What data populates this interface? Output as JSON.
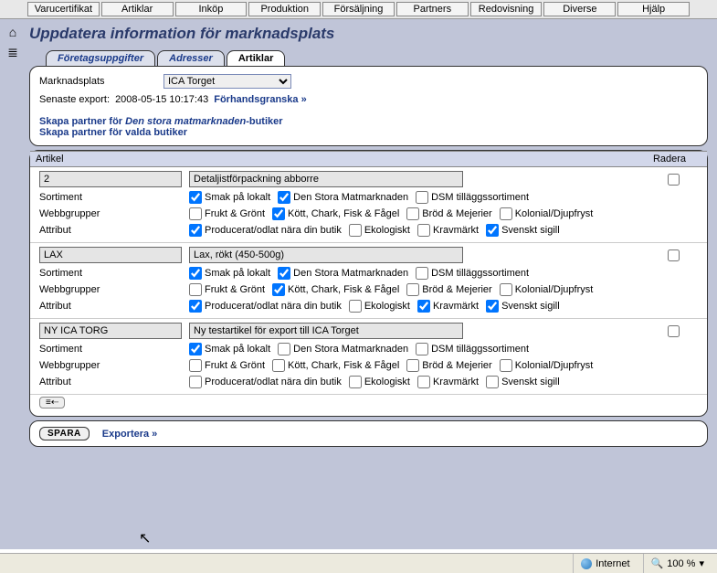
{
  "menu": [
    "Varucertifikat",
    "Artiklar",
    "Inköp",
    "Produktion",
    "Försäljning",
    "Partners",
    "Redovisning",
    "Diverse",
    "Hjälp"
  ],
  "page_title": "Uppdatera information för marknadsplats",
  "tabs": [
    {
      "label": "Företagsuppgifter",
      "active": false
    },
    {
      "label": "Adresser",
      "active": false
    },
    {
      "label": "Artiklar",
      "active": true
    }
  ],
  "marketplace": {
    "label": "Marknadsplats",
    "selected": "ICA Torget"
  },
  "export_line": {
    "prefix": "Senaste export: ",
    "ts": "2008-05-15 10:17:43",
    "preview": "Förhandsgranska »"
  },
  "partner_links": {
    "l1a": "Skapa partner för ",
    "l1b": "Den stora matmarknaden",
    "l1c": "-butiker",
    "l2": "Skapa partner för valda butiker"
  },
  "grid": {
    "col_article": "Artikel",
    "col_delete": "Radera"
  },
  "row_labels": {
    "sortiment": "Sortiment",
    "webbgrupper": "Webbgrupper",
    "attribut": "Attribut"
  },
  "sortiment_opts": [
    "Smak på lokalt",
    "Den Stora Matmarknaden",
    "DSM tilläggssortiment"
  ],
  "webb_opts": [
    "Frukt & Grönt",
    "Kött, Chark, Fisk & Fågel",
    "Bröd & Mejerier",
    "Kolonial/Djupfryst"
  ],
  "attr_opts": [
    "Producerat/odlat nära din butik",
    "Ekologiskt",
    "Kravmärkt",
    "Svenskt sigill"
  ],
  "articles": [
    {
      "id": "2",
      "name": "Detaljistförpackning abborre",
      "del": false,
      "sortiment": [
        true,
        true,
        false
      ],
      "webb": [
        false,
        true,
        false,
        false
      ],
      "attr": [
        true,
        false,
        false,
        true
      ]
    },
    {
      "id": "LAX",
      "name": "Lax, rökt (450-500g)",
      "del": false,
      "sortiment": [
        true,
        true,
        false
      ],
      "webb": [
        false,
        true,
        false,
        false
      ],
      "attr": [
        true,
        false,
        true,
        true
      ]
    },
    {
      "id": "NY ICA TORG",
      "name": "Ny testartikel för export till ICA Torget",
      "del": false,
      "sortiment": [
        true,
        false,
        false
      ],
      "webb": [
        false,
        false,
        false,
        false
      ],
      "attr": [
        false,
        false,
        false,
        false
      ]
    }
  ],
  "pager_glyph": "≡⇠",
  "footer": {
    "save": "SPARA",
    "export": "Exportera »"
  },
  "status": {
    "internet": "Internet",
    "zoom": "100 %"
  }
}
